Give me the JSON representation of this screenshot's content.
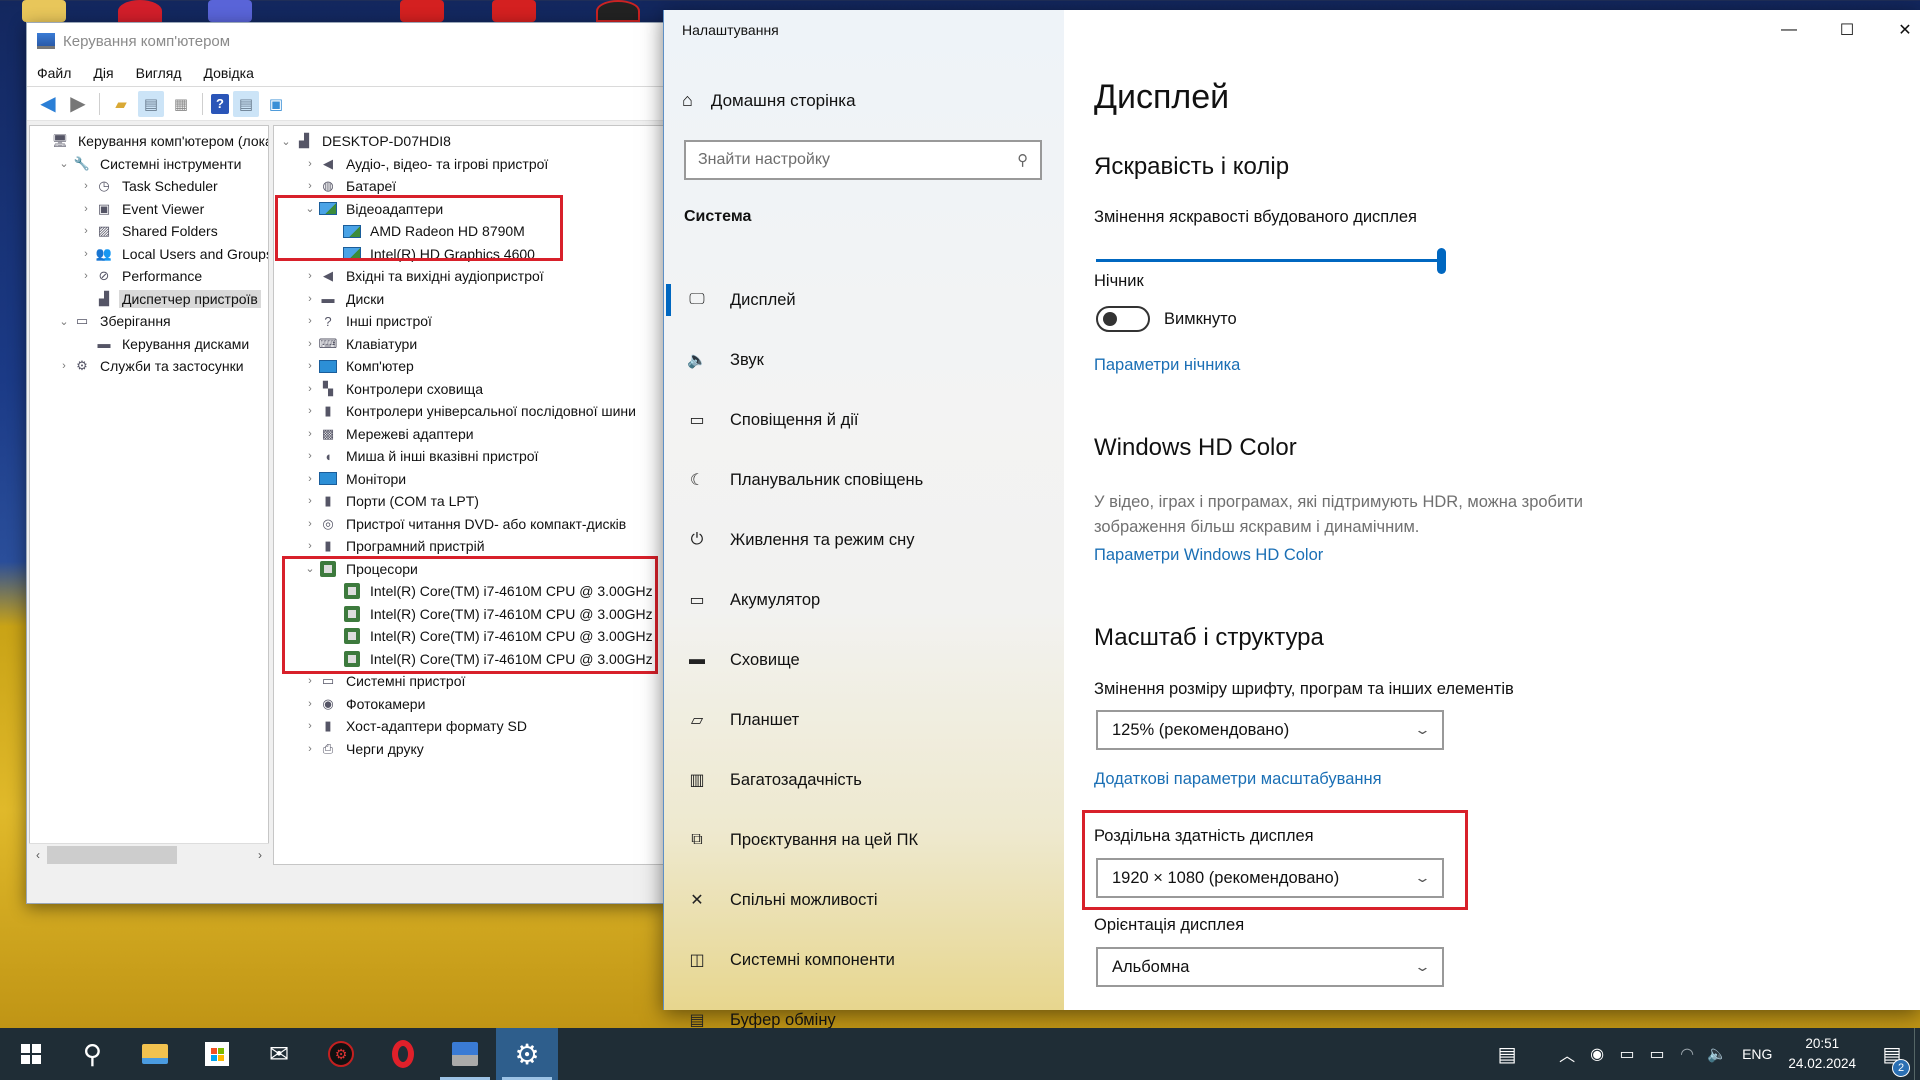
{
  "computer_management": {
    "title": "Керування комп'ютером",
    "menu": [
      "Файл",
      "Дія",
      "Вигляд",
      "Довідка"
    ],
    "left_tree": [
      {
        "label": "Керування комп'ютером (лока",
        "level": 0,
        "chevron": "",
        "icon": "computer-management-icon"
      },
      {
        "label": "Системні інструменти",
        "level": 1,
        "chevron": "expanded",
        "icon": "tools-icon"
      },
      {
        "label": "Task Scheduler",
        "level": 2,
        "chevron": "collapsed",
        "icon": "clock-icon"
      },
      {
        "label": "Event Viewer",
        "level": 2,
        "chevron": "collapsed",
        "icon": "event-viewer-icon"
      },
      {
        "label": "Shared Folders",
        "level": 2,
        "chevron": "collapsed",
        "icon": "shared-folder-icon"
      },
      {
        "label": "Local Users and Groups",
        "level": 2,
        "chevron": "collapsed",
        "icon": "users-icon"
      },
      {
        "label": "Performance",
        "level": 2,
        "chevron": "collapsed",
        "icon": "performance-icon"
      },
      {
        "label": "Диспетчер пристроїв",
        "level": 2,
        "chevron": "",
        "icon": "device-manager-icon",
        "selected": true
      },
      {
        "label": "Зберігання",
        "level": 1,
        "chevron": "expanded",
        "icon": "storage-icon"
      },
      {
        "label": "Керування дисками",
        "level": 2,
        "chevron": "",
        "icon": "disk-icon"
      },
      {
        "label": "Служби та застосунки",
        "level": 1,
        "chevron": "collapsed",
        "icon": "services-icon"
      }
    ],
    "device_tree": [
      {
        "label": "DESKTOP-D07HDI8",
        "level": 0,
        "chevron": "expanded",
        "icon": "computer-icon"
      },
      {
        "label": "Аудіо-, відео- та ігрові пристрої",
        "level": 1,
        "chevron": "collapsed",
        "icon": "speaker-icon"
      },
      {
        "label": "Батареї",
        "level": 1,
        "chevron": "collapsed",
        "icon": "battery-icon"
      },
      {
        "label": "Відеоадаптери",
        "level": 1,
        "chevron": "expanded",
        "icon": "display-adapter-icon"
      },
      {
        "label": "AMD Radeon HD 8790M",
        "level": 2,
        "chevron": "",
        "icon": "display-adapter-icon"
      },
      {
        "label": "Intel(R) HD Graphics 4600",
        "level": 2,
        "chevron": "",
        "icon": "display-adapter-icon"
      },
      {
        "label": "Вхідні та вихідні аудіопристрої",
        "level": 1,
        "chevron": "collapsed",
        "icon": "speaker-icon"
      },
      {
        "label": "Диски",
        "level": 1,
        "chevron": "collapsed",
        "icon": "disk-drive-icon"
      },
      {
        "label": "Інші пристрої",
        "level": 1,
        "chevron": "collapsed",
        "icon": "unknown-device-icon"
      },
      {
        "label": "Клавіатури",
        "level": 1,
        "chevron": "collapsed",
        "icon": "keyboard-icon"
      },
      {
        "label": "Комп'ютер",
        "level": 1,
        "chevron": "collapsed",
        "icon": "monitor-icon"
      },
      {
        "label": "Контролери сховища",
        "level": 1,
        "chevron": "collapsed",
        "icon": "storage-controller-icon"
      },
      {
        "label": "Контролери універсальної послідовної шини",
        "level": 1,
        "chevron": "collapsed",
        "icon": "usb-icon"
      },
      {
        "label": "Мережеві адаптери",
        "level": 1,
        "chevron": "collapsed",
        "icon": "network-icon"
      },
      {
        "label": "Миша й інші вказівні пристрої",
        "level": 1,
        "chevron": "collapsed",
        "icon": "mouse-icon"
      },
      {
        "label": "Монітори",
        "level": 1,
        "chevron": "collapsed",
        "icon": "monitor-icon"
      },
      {
        "label": "Порти (COM та LPT)",
        "level": 1,
        "chevron": "collapsed",
        "icon": "port-icon"
      },
      {
        "label": "Пристрої читання DVD- або компакт-дисків",
        "level": 1,
        "chevron": "collapsed",
        "icon": "dvd-icon"
      },
      {
        "label": "Програмний пристрій",
        "level": 1,
        "chevron": "collapsed",
        "icon": "software-device-icon"
      },
      {
        "label": "Процесори",
        "level": 1,
        "chevron": "expanded",
        "icon": "processor-icon"
      },
      {
        "label": "Intel(R) Core(TM) i7-4610M CPU @ 3.00GHz",
        "level": 2,
        "chevron": "",
        "icon": "processor-icon"
      },
      {
        "label": "Intel(R) Core(TM) i7-4610M CPU @ 3.00GHz",
        "level": 2,
        "chevron": "",
        "icon": "processor-icon"
      },
      {
        "label": "Intel(R) Core(TM) i7-4610M CPU @ 3.00GHz",
        "level": 2,
        "chevron": "",
        "icon": "processor-icon"
      },
      {
        "label": "Intel(R) Core(TM) i7-4610M CPU @ 3.00GHz",
        "level": 2,
        "chevron": "",
        "icon": "processor-icon"
      },
      {
        "label": "Системні пристрої",
        "level": 1,
        "chevron": "collapsed",
        "icon": "system-device-icon"
      },
      {
        "label": "Фотокамери",
        "level": 1,
        "chevron": "collapsed",
        "icon": "camera-icon"
      },
      {
        "label": "Хост-адаптери формату SD",
        "level": 1,
        "chevron": "collapsed",
        "icon": "sd-icon"
      },
      {
        "label": "Черги друку",
        "level": 1,
        "chevron": "collapsed",
        "icon": "printer-icon"
      }
    ]
  },
  "settings": {
    "app_title": "Налаштування",
    "home_label": "Домашня сторінка",
    "search_placeholder": "Знайти настройку",
    "section_label": "Система",
    "nav": [
      {
        "label": "Дисплей",
        "icon": "display-icon",
        "active": true
      },
      {
        "label": "Звук",
        "icon": "sound-icon"
      },
      {
        "label": "Сповіщення й дії",
        "icon": "notifications-icon"
      },
      {
        "label": "Планувальник сповіщень",
        "icon": "moon-icon"
      },
      {
        "label": "Живлення та режим сну",
        "icon": "power-icon"
      },
      {
        "label": "Акумулятор",
        "icon": "battery-icon"
      },
      {
        "label": "Сховище",
        "icon": "storage-icon"
      },
      {
        "label": "Планшет",
        "icon": "tablet-icon"
      },
      {
        "label": "Багатозадачність",
        "icon": "multitasking-icon"
      },
      {
        "label": "Проєктування на цей ПК",
        "icon": "projecting-icon"
      },
      {
        "label": "Спільні можливості",
        "icon": "shared-experiences-icon"
      },
      {
        "label": "Системні компоненти",
        "icon": "system-components-icon"
      },
      {
        "label": "Буфер обміну",
        "icon": "clipboard-icon"
      }
    ],
    "page_title": "Дисплей",
    "brightness": {
      "heading": "Яскравість і колір",
      "slider_label": "Змінення яскравості вбудованого дисплея",
      "value_percent": 100
    },
    "night_light": {
      "label": "Нічник",
      "state_label": "Вимкнуто",
      "enabled": false,
      "link": "Параметри нічника"
    },
    "hd_color": {
      "heading": "Windows HD Color",
      "description": "У відео, іграх і програмах, які підтримують HDR, можна зробити зображення більш яскравим і динамічним.",
      "link": "Параметри Windows HD Color"
    },
    "scale_layout": {
      "heading": "Масштаб і структура",
      "scale_label": "Змінення розміру шрифту, програм та інших елементів",
      "scale_value": "125% (рекомендовано)",
      "advanced_link": "Додаткові параметри масштабування",
      "resolution_label": "Роздільна здатність дисплея",
      "resolution_value": "1920 × 1080 (рекомендовано)",
      "orientation_label": "Орієнтація дисплея",
      "orientation_value": "Альбомна"
    },
    "window_controls": {
      "minimize": "—",
      "maximize": "☐",
      "close": "✕"
    }
  },
  "taskbar": {
    "apps": [
      {
        "name": "start",
        "icon": "windows-logo-icon"
      },
      {
        "name": "search",
        "icon": "search-icon"
      },
      {
        "name": "file-explorer",
        "icon": "folder-icon"
      },
      {
        "name": "microsoft-store",
        "icon": "store-icon"
      },
      {
        "name": "mail",
        "icon": "mail-icon"
      },
      {
        "name": "game-app",
        "icon": "gear-red-icon"
      },
      {
        "name": "opera",
        "icon": "opera-icon"
      },
      {
        "name": "computer-management",
        "icon": "computer-management-icon",
        "running": true
      },
      {
        "name": "settings",
        "icon": "gear-icon",
        "running": true,
        "active": true
      }
    ],
    "language": "ENG",
    "time": "20:51",
    "date": "24.02.2024",
    "notification_count": "2"
  },
  "highlight_color": "#d8202a",
  "accent_color": "#0067c0"
}
